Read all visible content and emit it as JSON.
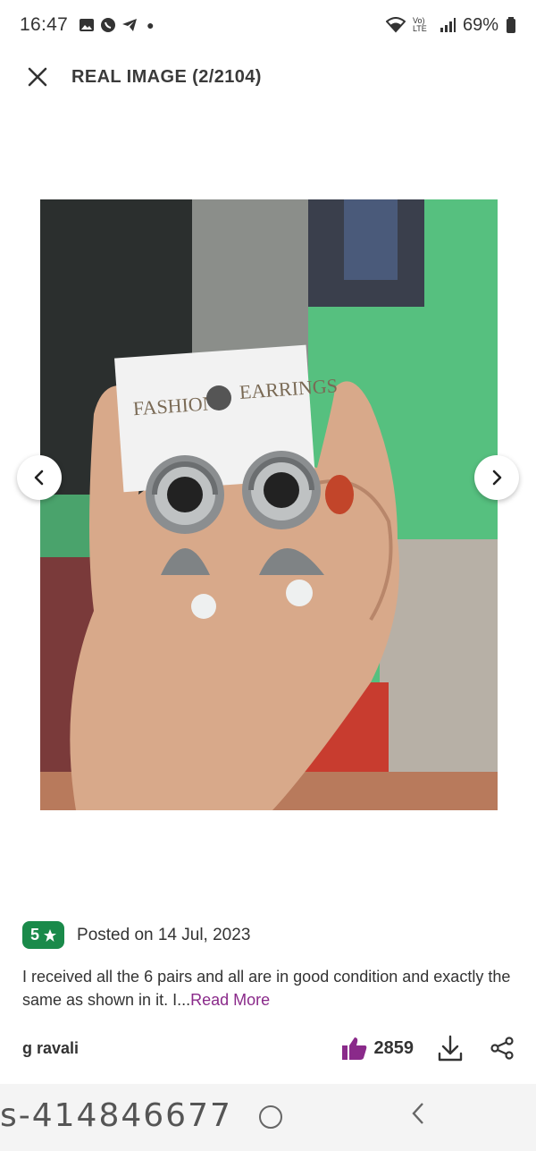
{
  "status_bar": {
    "time": "16:47",
    "battery": "69%",
    "network": "Vo) LTE"
  },
  "top_bar": {
    "title": "REAL IMAGE (2/2104)"
  },
  "photo": {
    "card_left_text": "FASHION",
    "card_right_text": "EARRINGS"
  },
  "review": {
    "rating": "5",
    "rating_color": "#1a8a4a",
    "posted": "Posted on 14 Jul, 2023",
    "text": "I received all the 6 pairs and all are in good condition and exactly the same as shown in it. I...",
    "read_more": "Read More",
    "reviewer": "g ravali",
    "likes": "2859"
  },
  "watermark": "s-414846677",
  "colors": {
    "accent_purple": "#8a2a8a",
    "badge_green": "#1a8a4a"
  }
}
